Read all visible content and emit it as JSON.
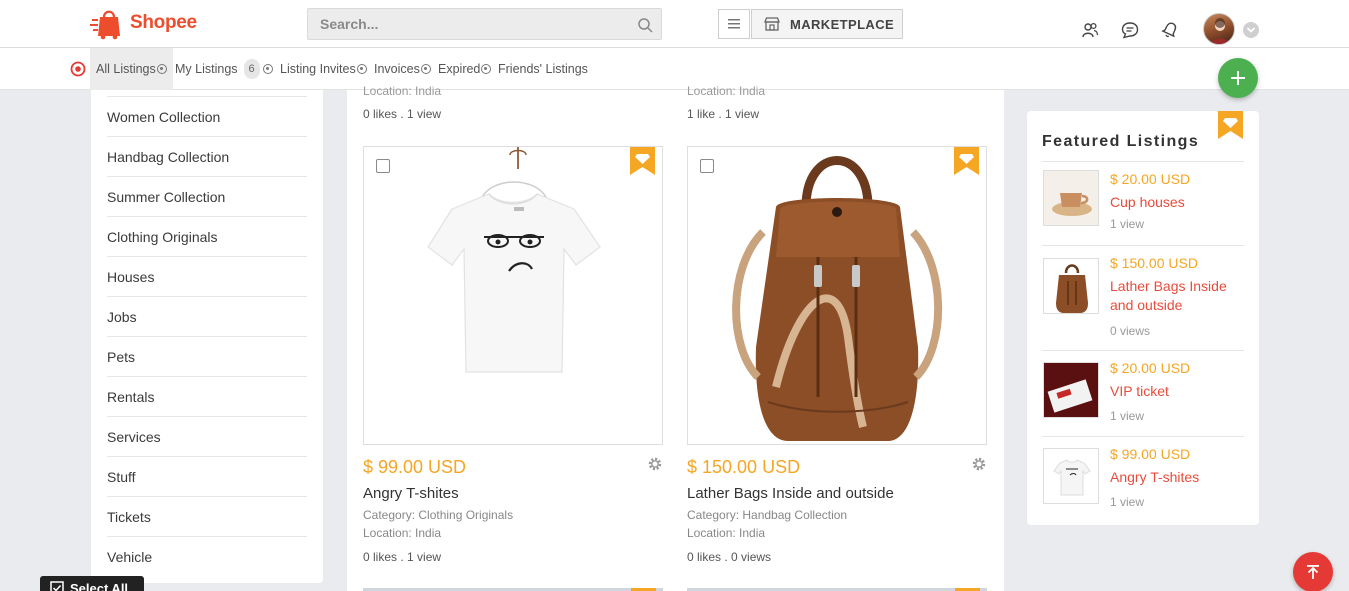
{
  "app": {
    "brand": "Shopee",
    "brand_color": "#ee4d2d"
  },
  "search": {
    "placeholder": "Search..."
  },
  "header": {
    "marketplace_label": "MARKETPLACE",
    "icons": [
      "users-icon",
      "chat-icon",
      "bell-icon",
      "avatar",
      "chevron-down-icon"
    ]
  },
  "subnav": {
    "tabs": [
      {
        "label": "All Listings",
        "active": true
      },
      {
        "label": "My Listings",
        "badge": "6"
      },
      {
        "label": "Listing Invites"
      },
      {
        "label": "Invoices"
      },
      {
        "label": "Expired"
      },
      {
        "label": "Friends' Listings"
      }
    ]
  },
  "sidebar": {
    "categories": [
      "Women Collection",
      "Handbag Collection",
      "Summer Collection",
      "Clothing Originals",
      "Houses",
      "Jobs",
      "Pets",
      "Rentals",
      "Services",
      "Stuff",
      "Tickets",
      "Vehicle"
    ]
  },
  "select_all": "Select All",
  "partial_top": [
    {
      "location": "Location: India",
      "likes": "0 likes",
      "sep": ".",
      "views": "1 view"
    },
    {
      "location": "Location: India",
      "likes": "1 like",
      "sep": ".",
      "views": "1 view"
    }
  ],
  "listings": [
    {
      "price": "$ 99.00 USD",
      "title": "Angry T-shites",
      "category": "Category: Clothing Originals",
      "location": "Location: India",
      "likes": "0 likes",
      "sep": ".",
      "views": "1 view"
    },
    {
      "price": "$ 150.00 USD",
      "title": "Lather Bags Inside and outside",
      "category": "Category: Handbag Collection",
      "location": "Location: India",
      "likes": "0 likes",
      "sep": ".",
      "views": "0 views"
    }
  ],
  "featured": {
    "title": "Featured Listings",
    "items": [
      {
        "price": "$ 20.00 USD",
        "name": "Cup houses",
        "views": "1 view"
      },
      {
        "price": "$ 150.00 USD",
        "name": "Lather Bags Inside and outside",
        "views": "0 views"
      },
      {
        "price": "$ 20.00 USD",
        "name": "VIP ticket",
        "views": "1 view"
      },
      {
        "price": "$ 99.00 USD",
        "name": "Angry T-shites",
        "views": "1 view"
      }
    ]
  },
  "colors": {
    "price": "#f5a623",
    "featured_name": "#e74c3c",
    "add_button": "#4caf50",
    "scroll_top_button": "#e53935"
  }
}
